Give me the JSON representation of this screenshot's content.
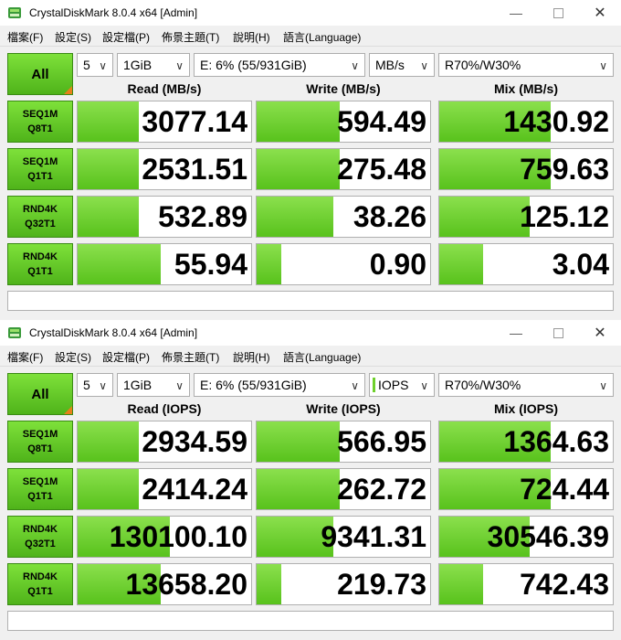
{
  "windows": [
    {
      "title": "CrystalDiskMark 8.0.4 x64 [Admin]",
      "menu": [
        "檔案(F)",
        "設定(S)",
        "設定檔(P)",
        "佈景主題(T)",
        "說明(H)",
        "語言(Language)"
      ],
      "all_label": "All",
      "count": "5",
      "size": "1GiB",
      "drive": "E: 6% (55/931GiB)",
      "unit": "MB/s",
      "mix": "R70%/W30%",
      "headers": [
        "Read (MB/s)",
        "Write (MB/s)",
        "Mix (MB/s)"
      ],
      "rows": [
        {
          "label1": "SEQ1M",
          "label2": "Q8T1",
          "read": "3077.14",
          "write": "594.49",
          "mix": "1430.92",
          "fill": [
            0.35,
            0.48,
            0.64
          ]
        },
        {
          "label1": "SEQ1M",
          "label2": "Q1T1",
          "read": "2531.51",
          "write": "275.48",
          "mix": "759.63",
          "fill": [
            0.35,
            0.48,
            0.64
          ]
        },
        {
          "label1": "RND4K",
          "label2": "Q32T1",
          "read": "532.89",
          "write": "38.26",
          "mix": "125.12",
          "fill": [
            0.35,
            0.44,
            0.52
          ]
        },
        {
          "label1": "RND4K",
          "label2": "Q1T1",
          "read": "55.94",
          "write": "0.90",
          "mix": "3.04",
          "fill": [
            0.48,
            0.14,
            0.25
          ]
        }
      ],
      "comment": ""
    },
    {
      "title": "CrystalDiskMark 8.0.4 x64 [Admin]",
      "menu": [
        "檔案(F)",
        "設定(S)",
        "設定檔(P)",
        "佈景主題(T)",
        "說明(H)",
        "語言(Language)"
      ],
      "all_label": "All",
      "count": "5",
      "size": "1GiB",
      "drive": "E: 6% (55/931GiB)",
      "unit": "IOPS",
      "mix": "R70%/W30%",
      "headers": [
        "Read (IOPS)",
        "Write (IOPS)",
        "Mix (IOPS)"
      ],
      "rows": [
        {
          "label1": "SEQ1M",
          "label2": "Q8T1",
          "read": "2934.59",
          "write": "566.95",
          "mix": "1364.63",
          "fill": [
            0.35,
            0.48,
            0.64
          ]
        },
        {
          "label1": "SEQ1M",
          "label2": "Q1T1",
          "read": "2414.24",
          "write": "262.72",
          "mix": "724.44",
          "fill": [
            0.35,
            0.48,
            0.64
          ]
        },
        {
          "label1": "RND4K",
          "label2": "Q32T1",
          "read": "130100.10",
          "write": "9341.31",
          "mix": "30546.39",
          "fill": [
            0.53,
            0.44,
            0.52
          ]
        },
        {
          "label1": "RND4K",
          "label2": "Q1T1",
          "read": "13658.20",
          "write": "219.73",
          "mix": "742.43",
          "fill": [
            0.48,
            0.14,
            0.25
          ]
        }
      ],
      "comment": ""
    }
  ],
  "colors": {
    "accent_green": "#6fd02c",
    "bar_green": "#58c21c"
  }
}
